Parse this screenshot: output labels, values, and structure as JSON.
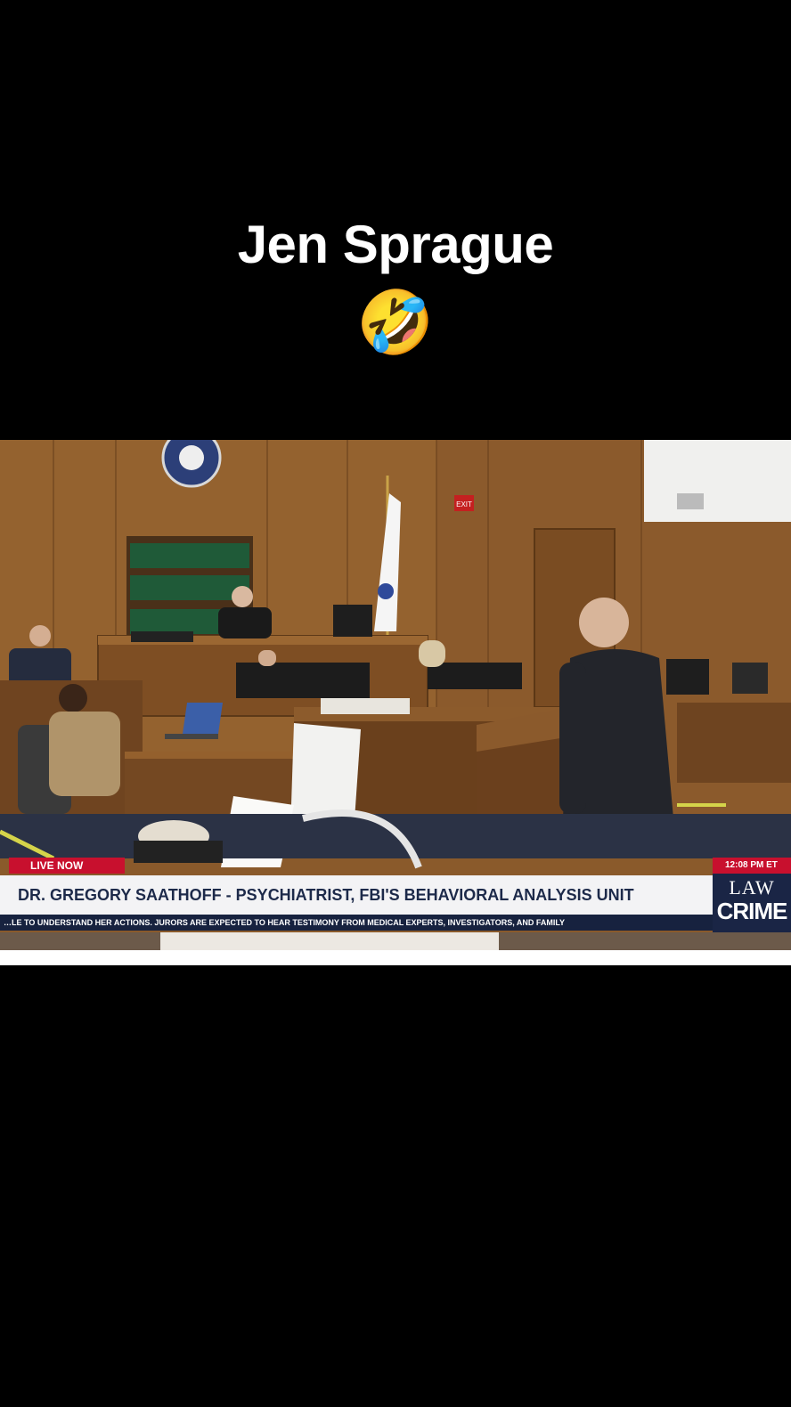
{
  "caption": {
    "title": "Jen Sprague",
    "emoji": "😂🤣😂"
  },
  "broadcast": {
    "live_label": "LIVE NOW",
    "time_label": "12:08 PM ET",
    "lower_third_title": "DR. GREGORY SAATHOFF - PSYCHIATRIST, FBI'S BEHAVIORAL ANALYSIS UNIT",
    "ticker_text": "…LE TO UNDERSTAND HER ACTIONS. JURORS ARE EXPECTED TO HEAR TESTIMONY FROM MEDICAL EXPERTS, INVESTIGATORS, AND FAMILY",
    "logo_line1": "LAW",
    "logo_line2": "CRIME",
    "exit_sign": "EXIT"
  },
  "colors": {
    "live_red": "#c8102e",
    "lower_third_bg": "#f3f3f5",
    "lower_third_text": "#1d2a4a",
    "ticker_bg": "#17223f",
    "wood_paneling": "#8a5a2b"
  }
}
